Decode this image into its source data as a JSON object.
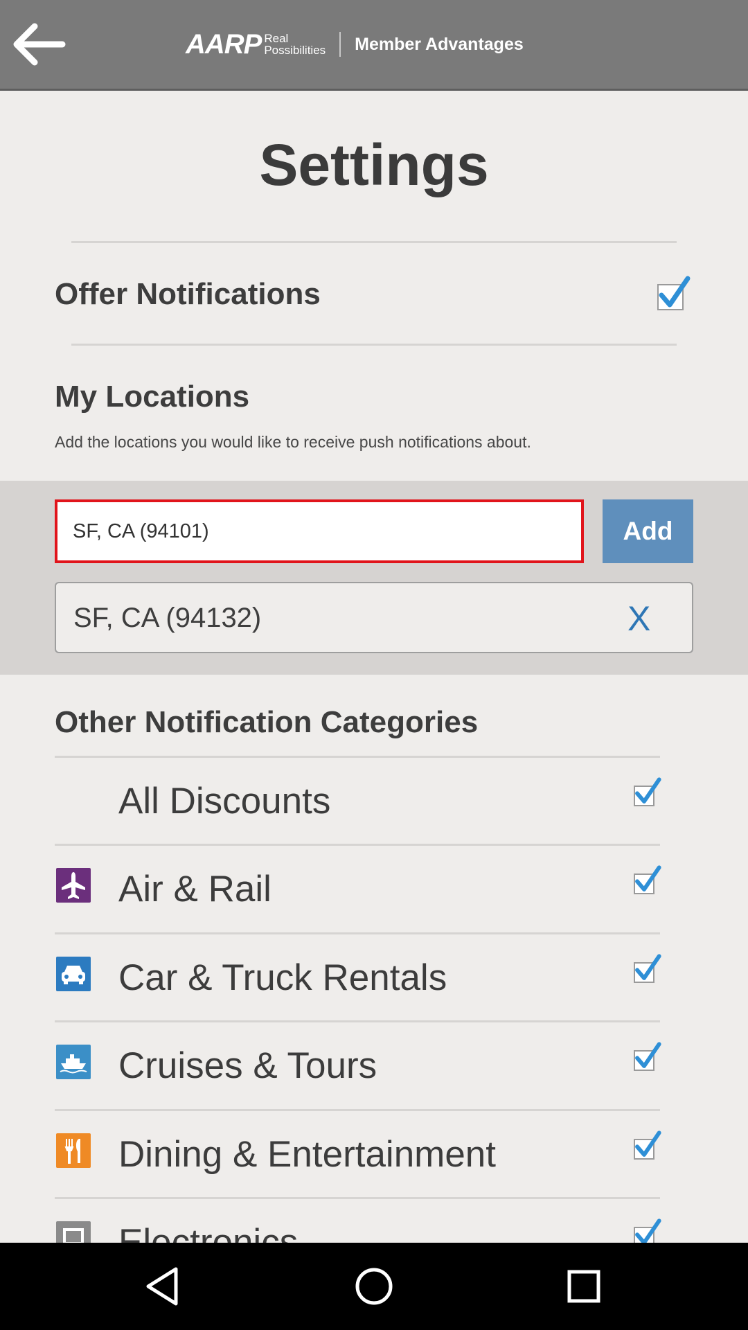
{
  "header": {
    "back_icon": "arrow-left-icon",
    "brand": "AARP",
    "tagline_line1": "Real",
    "tagline_line2": "Possibilities",
    "section_name": "Member Advantages"
  },
  "page_title": "Settings",
  "offer_notifications": {
    "label": "Offer Notifications",
    "checked": true
  },
  "my_locations": {
    "title": "My Locations",
    "description": "Add the locations you would like to receive push notifications about.",
    "input_value": "SF, CA (94101)",
    "add_label": "Add",
    "saved": [
      {
        "label": "SF, CA (94132)",
        "remove_label": "X"
      }
    ]
  },
  "other_categories": {
    "title": "Other Notification Categories",
    "items": [
      {
        "label": "All Discounts",
        "icon": "",
        "checked": true
      },
      {
        "label": "Air & Rail",
        "icon": "airplane-icon",
        "color": "#6b2f7c",
        "checked": true
      },
      {
        "label": "Car & Truck Rentals",
        "icon": "car-icon",
        "color": "#2c7bc0",
        "checked": true
      },
      {
        "label": "Cruises & Tours",
        "icon": "ship-icon",
        "color": "#3b8fc7",
        "checked": true
      },
      {
        "label": "Dining & Entertainment",
        "icon": "utensils-icon",
        "color": "#ef8a25",
        "checked": true
      },
      {
        "label": "Electronics",
        "icon": "tv-icon",
        "color": "#8a8a8a",
        "checked": true
      }
    ]
  },
  "colors": {
    "accent": "#5f8fbc",
    "error_border": "#e1141b",
    "checkmark": "#2e8fd6",
    "remove": "#2e76b5"
  },
  "system_nav": {
    "back": "nav-back-icon",
    "home": "nav-home-icon",
    "recents": "nav-recents-icon"
  }
}
